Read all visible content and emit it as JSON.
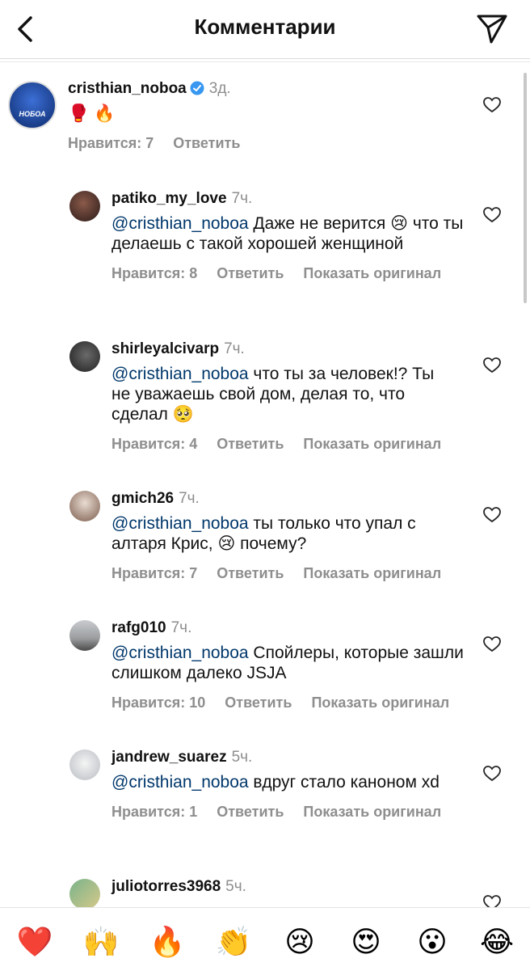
{
  "header": {
    "title": "Комментарии"
  },
  "main_comment": {
    "username": "cristhian_noboa",
    "time": "3д.",
    "emojis": "🥊 🔥",
    "likes": "Нравится: 7",
    "reply": "Ответить",
    "avatar_text": "НОБОА"
  },
  "replies": [
    {
      "username": "patiko_my_love",
      "time": "7ч.",
      "mention": "@cristhian_noboa",
      "text": " Даже не верится 😢 что ты делаешь с такой хорошей женщиной",
      "likes": "Нравится: 8",
      "reply": "Ответить",
      "original": "Показать оригинал"
    },
    {
      "username": "shirleyalcivarp",
      "time": "7ч.",
      "mention": "@cristhian_noboa",
      "text": " что ты за человек!? Ты не уважаешь свой дом, делая то, что сделал 🥺",
      "likes": "Нравится: 4",
      "reply": "Ответить",
      "original": "Показать оригинал"
    },
    {
      "username": "gmich26",
      "time": "7ч.",
      "mention": "@cristhian_noboa",
      "text": " ты только что упал с алтаря Крис, 😢 почему?",
      "likes": "Нравится: 7",
      "reply": "Ответить",
      "original": "Показать оригинал"
    },
    {
      "username": "rafg010",
      "time": "7ч.",
      "mention": "@cristhian_noboa",
      "text": " Спойлеры, которые зашли слишком далеко JSJA",
      "likes": "Нравится: 10",
      "reply": "Ответить",
      "original": "Показать оригинал"
    },
    {
      "username": "jandrew_suarez",
      "time": "5ч.",
      "mention": "@cristhian_noboa",
      "text": " вдруг стало каноном xd",
      "likes": "Нравится: 1",
      "reply": "Ответить",
      "original": "Показать оригинал"
    },
    {
      "username": "juliotorres3968",
      "time": "5ч."
    }
  ],
  "emoji_bar": [
    "❤️",
    "🙌",
    "🔥",
    "👏",
    "😢",
    "😍",
    "😮",
    "😂"
  ],
  "colors": {
    "mention": "#00376b",
    "meta_gray": "#8e8e8e",
    "verified": "#3897f0"
  }
}
